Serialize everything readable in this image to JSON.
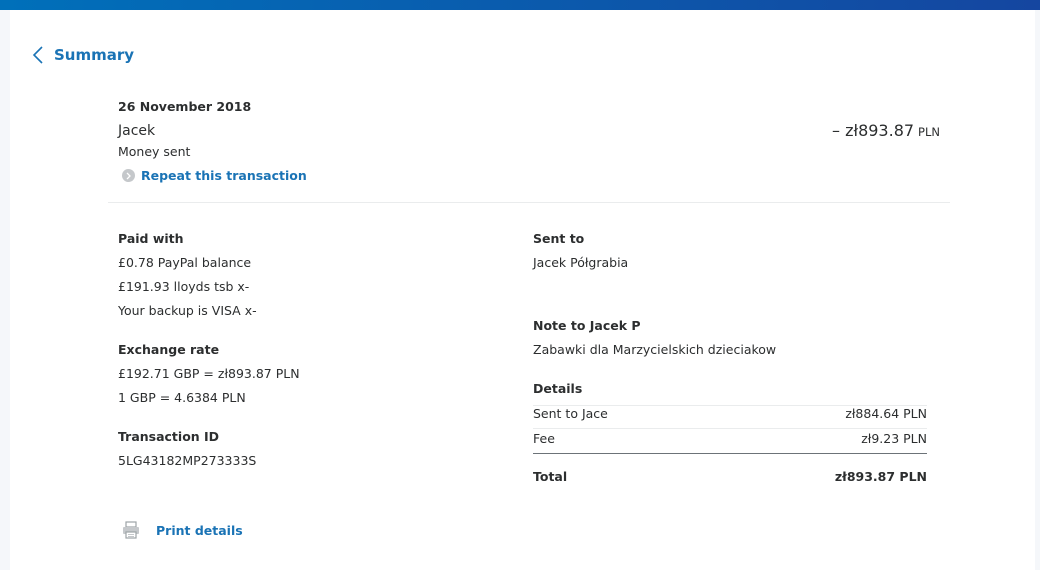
{
  "colors": {
    "accent": "#1a73b5",
    "text": "#2c2e2f",
    "top_bar": "#0070ba"
  },
  "header": {
    "back_label": "Summary"
  },
  "transaction": {
    "date": "26 November 2018",
    "name": "Jacek",
    "type": "Money sent",
    "amount": "– zł893.87",
    "currency": "PLN",
    "repeat_label": "Repeat this transaction"
  },
  "paid_with": {
    "heading": "Paid with",
    "lines": [
      "£0.78 PayPal balance",
      "£191.93 lloyds tsb x-",
      "Your backup is VISA x-"
    ]
  },
  "exchange": {
    "heading": "Exchange rate",
    "lines": [
      "£192.71 GBP = zł893.87 PLN",
      "1 GBP = 4.6384 PLN"
    ]
  },
  "transaction_id": {
    "heading": "Transaction ID",
    "value": "5LG43182MP273333S"
  },
  "sent_to": {
    "heading": "Sent to",
    "name": "Jacek Półgrabia"
  },
  "note": {
    "heading": "Note to Jacek P",
    "text": "Zabawki dla Marzycielskich dzieciakow"
  },
  "details": {
    "heading": "Details",
    "rows": [
      {
        "label": "Sent to Jace",
        "value": "zł884.64 PLN"
      },
      {
        "label": "Fee",
        "value": "zł9.23 PLN"
      }
    ],
    "total_label": "Total",
    "total_value": "zł893.87 PLN"
  },
  "print_label": "Print details"
}
